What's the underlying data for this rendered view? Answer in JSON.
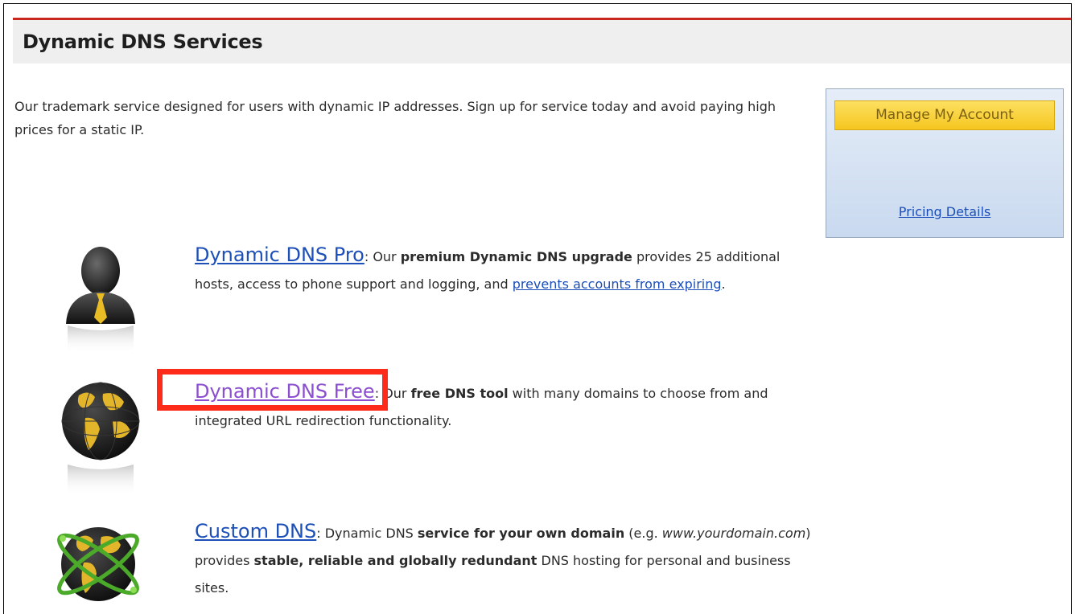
{
  "header": {
    "title": "Dynamic DNS Services"
  },
  "intro": "Our trademark service designed for users with dynamic IP addresses. Sign up for service today and avoid paying high prices for a static IP.",
  "side_box": {
    "manage_button": "Manage My Account",
    "pricing_link": "Pricing Details"
  },
  "services": [
    {
      "name": "Dynamic DNS Pro",
      "text_a": ": Our ",
      "bold_a": "premium Dynamic DNS upgrade",
      "text_b": " provides 25 additional hosts, access to phone support and logging, and ",
      "link": "prevents accounts from expiring",
      "text_c": ".",
      "icon": "user-icon"
    },
    {
      "name": "Dynamic DNS Free",
      "text_a": ": Our ",
      "bold_a": "free DNS tool",
      "text_b": " with many domains to choose from and integrated URL redirection functionality.",
      "icon": "globe-icon"
    },
    {
      "name": "Custom DNS",
      "text_a": ": Dynamic DNS ",
      "bold_a": "service for your own domain",
      "text_b": " (e.g. ",
      "italic": "www.yourdomain.com",
      "text_c": ") provides ",
      "bold_b": "stable, reliable and globally redundant",
      "text_d": " DNS hosting for personal and business sites.",
      "icon": "orbit-globe-icon"
    }
  ],
  "colors": {
    "accent_red": "#c8281e",
    "link": "#1c4fb8",
    "highlight": "#ff2b1a",
    "button": "#f5c61f"
  }
}
